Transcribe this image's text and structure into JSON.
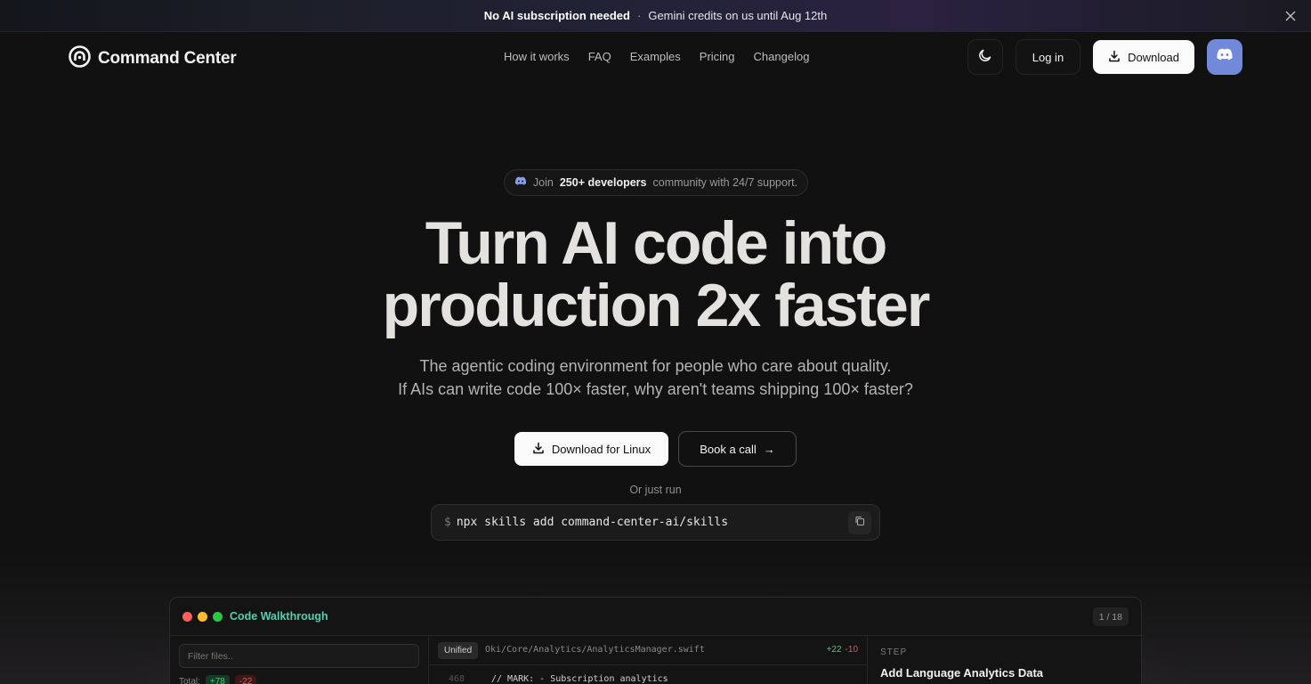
{
  "announcement": {
    "strong": "No AI subscription needed",
    "separator": "·",
    "text": "Gemini credits on us until Aug 12th"
  },
  "brand": {
    "name": "Command Center"
  },
  "nav": {
    "items": [
      {
        "label": "How it works"
      },
      {
        "label": "FAQ"
      },
      {
        "label": "Examples"
      },
      {
        "label": "Pricing"
      },
      {
        "label": "Changelog"
      }
    ],
    "login_label": "Log in",
    "download_label": "Download"
  },
  "hero": {
    "pill": {
      "prefix": "Join",
      "highlight": "250+ developers",
      "suffix": "community with 24/7 support."
    },
    "headline_line1": "Turn AI code into",
    "headline_line2": "production 2x faster",
    "sub_line1": "The agentic coding environment for people who care about quality.",
    "sub_line2": "If AIs can write code 100× faster, why aren't teams shipping 100× faster?",
    "cta_primary": "Download for Linux",
    "cta_secondary": "Book a call",
    "cta_secondary_arrow": "→",
    "or_run": "Or just run",
    "cmd_prompt": "$",
    "cmd_text": "npx skills add command-center-ai/skills"
  },
  "walkthrough": {
    "title": "Code Walkthrough",
    "page_count": "1 / 18",
    "filter_placeholder": "Filter files..",
    "total_label": "Total:",
    "total_add": "+78",
    "total_del": "-22",
    "view_mode": "Unified",
    "file_path": "Oki/Core/Analytics/AnalyticsManager.swift",
    "file_add": "+22",
    "file_del": "-10",
    "line_number": "468",
    "line_text": "// MARK: - Subscription analytics",
    "step_label": "STEP",
    "step_title": "Add Language Analytics Data"
  },
  "colors": {
    "background": "#111111",
    "accent_green": "#4fd1b0",
    "discord": "#7289da",
    "add": "#3fcf7a",
    "delete": "#e45757"
  },
  "icons": {
    "close": "close-icon",
    "logo": "command-center-logo-icon",
    "theme": "moon-icon",
    "download": "download-icon",
    "discord": "discord-icon",
    "copy": "copy-icon"
  }
}
